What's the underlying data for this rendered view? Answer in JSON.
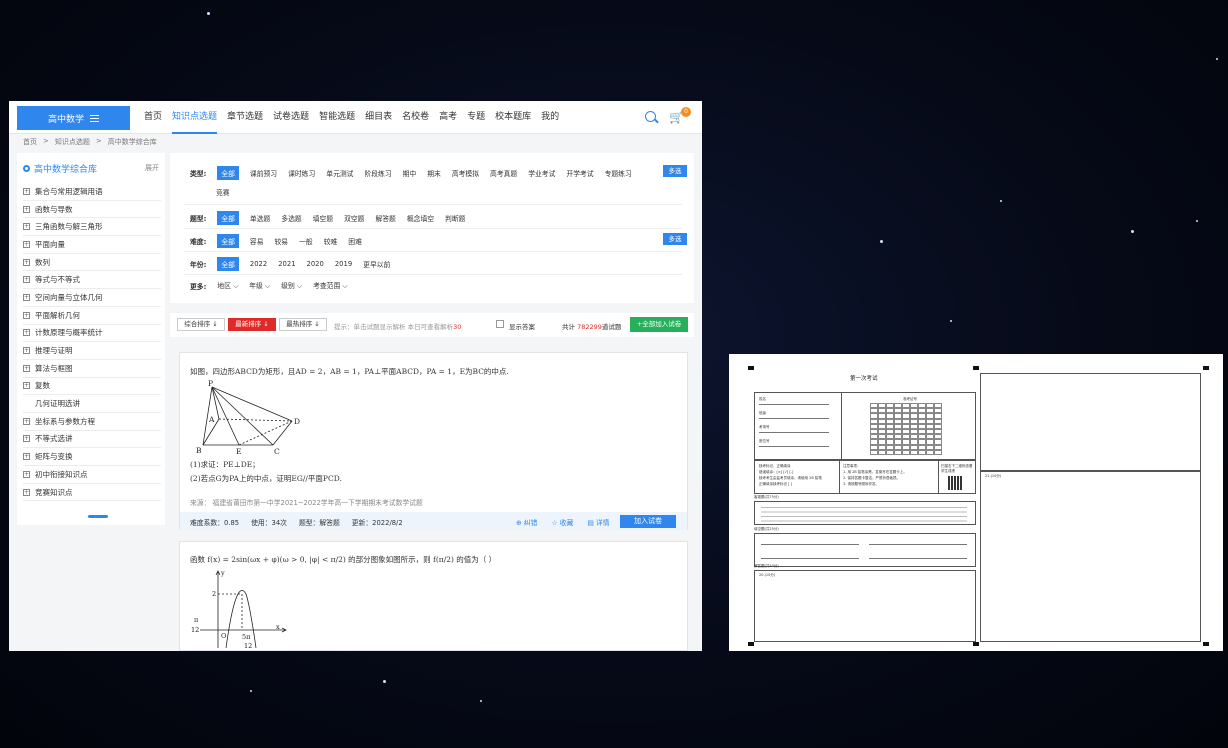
{
  "web": {
    "subject_button": "高中数学",
    "nav": [
      "首页",
      "知识点选题",
      "章节选题",
      "试卷选题",
      "智能选题",
      "细目表",
      "名校卷",
      "高考",
      "专题",
      "校本题库",
      "我的"
    ],
    "nav_active_index": 1,
    "cart_count": "0",
    "breadcrumb": [
      "首页",
      ">",
      "知识点选题",
      ">",
      "高中数学综合库"
    ],
    "sidebar": {
      "title": "高中数学综合库",
      "expand": "展开",
      "items": [
        {
          "label": "集合与常用逻辑用语",
          "plus": true
        },
        {
          "label": "函数与导数",
          "plus": true
        },
        {
          "label": "三角函数与解三角形",
          "plus": true
        },
        {
          "label": "平面向量",
          "plus": true
        },
        {
          "label": "数列",
          "plus": true
        },
        {
          "label": "等式与不等式",
          "plus": true
        },
        {
          "label": "空间向量与立体几何",
          "plus": true
        },
        {
          "label": "平面解析几何",
          "plus": true
        },
        {
          "label": "计数原理与概率统计",
          "plus": true
        },
        {
          "label": "推理与证明",
          "plus": true
        },
        {
          "label": "算法与框图",
          "plus": true
        },
        {
          "label": "复数",
          "plus": true
        },
        {
          "label": "几何证明选讲",
          "plus": false
        },
        {
          "label": "坐标系与参数方程",
          "plus": true
        },
        {
          "label": "不等式选讲",
          "plus": true
        },
        {
          "label": "矩阵与变换",
          "plus": true
        },
        {
          "label": "初中衔接知识点",
          "plus": true
        },
        {
          "label": "竞赛知识点",
          "plus": true
        }
      ]
    },
    "filters": {
      "type_label": "类型:",
      "types": [
        "全部",
        "课前预习",
        "课时练习",
        "单元测试",
        "阶段练习",
        "期中",
        "期末",
        "高考模拟",
        "高考真题",
        "学业考试",
        "开学考试",
        "专题练习"
      ],
      "types_row2": [
        "竞赛"
      ],
      "multi": "多选",
      "qtype_label": "题型:",
      "qtypes": [
        "全部",
        "单选题",
        "多选题",
        "填空题",
        "双空题",
        "解答题",
        "概念填空",
        "判断题"
      ],
      "difficulty_label": "难度:",
      "difficulties": [
        "全部",
        "容易",
        "较易",
        "一般",
        "较难",
        "困难"
      ],
      "year_label": "年份:",
      "years": [
        "全部",
        "2022",
        "2021",
        "2020",
        "2019",
        "更早以前"
      ],
      "more_label": "更多:",
      "more": [
        "地区",
        "年级",
        "级别",
        "考查范围"
      ]
    },
    "sortbar": {
      "sort_all": "综合排序 ↓",
      "sort_new": "最新排序 ↓",
      "sort_hot": "最热排序 ↓",
      "tip": "提示：单击试题显示解析 本日可查看解析",
      "tip_count": "30",
      "show_answer": "显示答案",
      "total_prefix": "共计",
      "total_count": "782299",
      "total_suffix": "道试题",
      "add_all": "+全部加入试卷"
    },
    "q1": {
      "stem": "如图，四边形ABCD为矩形，且AD = 2，AB = 1，PA⊥平面ABCD，PA = 1，E为BC的中点.",
      "part1": "(1)求证：PE⊥DE；",
      "part2": "(2)若点G为PA上的中点，证明EG//平面PCD.",
      "fig_labels": [
        "P",
        "A",
        "D",
        "B",
        "E",
        "C"
      ],
      "source": "来源： 福建省莆田市第一中学2021~2022学年高一下学期期末考试数学试题",
      "difficulty": "难度系数：0.85",
      "uses": "使用：34次",
      "qtype": "题型：解答题",
      "updated": "更新：2022/8/2",
      "actions": [
        "纠错",
        "收藏",
        "详情"
      ],
      "add": "加入试卷"
    },
    "q2": {
      "stem": "函数 f(x) = 2sin(ωx + φ)(ω > 0, |φ| < π/2) 的部分图象如图所示，则 f(π/2) 的值为（     ）",
      "fig_labels": [
        "y",
        "2",
        "π",
        "12",
        "O",
        "5π",
        "12",
        "x"
      ]
    }
  },
  "sheet": {
    "title": "第一次考试",
    "fields": [
      "姓名",
      "班级",
      "考场号",
      "座位号"
    ],
    "zkzh": "准考证号",
    "notes_left": [
      "缺考标记，正确填涂",
      "错误填涂：[×] [√] [-]",
      "缺考考生由监考员填涂，请使用 2B 铅笔",
      "正确填涂缺考标记 [ ]"
    ],
    "notes_right": [
      "注意事项：",
      "1. 用 2B 铅笔涂黑，答案写在答题卡上。",
      "2. 保持答题卡整洁，严禁折叠破损。",
      "3. 请按题号顺序作答。"
    ],
    "qr_text": "扫描右下二维码查看学生成绩",
    "sec1": "客观题(共75分)",
    "sec2": "填空题(共25分)",
    "sec3": "解答题(共40分)",
    "q21": "21.(10分)",
    "q22": "22.(10分)",
    "q20": "20.(10分)"
  }
}
